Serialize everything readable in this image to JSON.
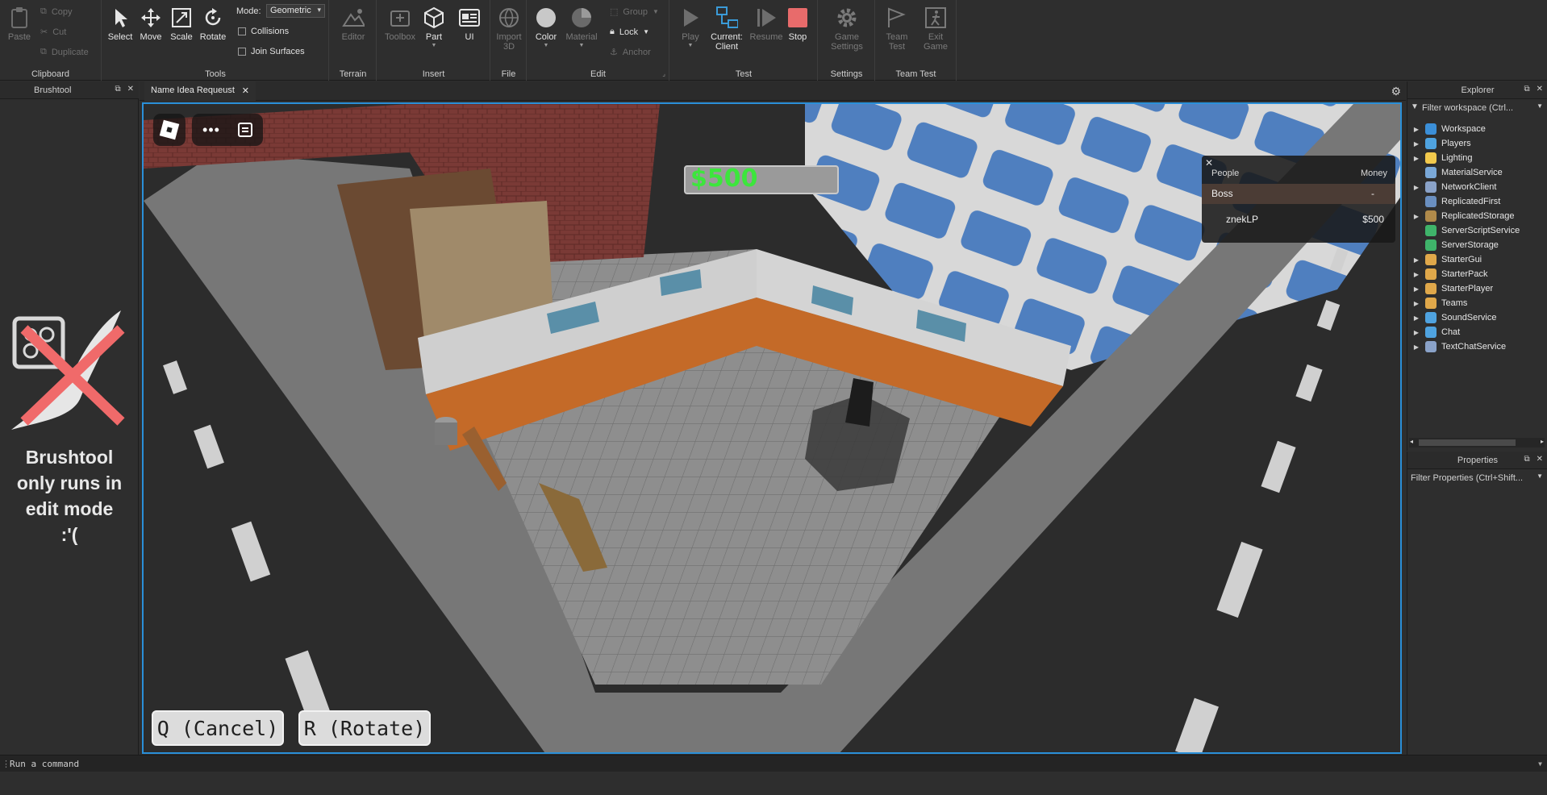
{
  "ribbon": {
    "clipboard": {
      "label": "Clipboard",
      "paste": "Paste",
      "copy": "Copy",
      "cut": "Cut",
      "duplicate": "Duplicate"
    },
    "tools": {
      "label": "Tools",
      "select": "Select",
      "move": "Move",
      "scale": "Scale",
      "rotate": "Rotate",
      "mode_label": "Mode:",
      "mode_value": "Geometric",
      "collisions": "Collisions",
      "join_surfaces": "Join Surfaces"
    },
    "terrain": {
      "label": "Terrain",
      "editor": "Editor"
    },
    "insert": {
      "label": "Insert",
      "toolbox": "Toolbox",
      "part": "Part",
      "ui": "UI"
    },
    "file": {
      "label": "File",
      "import3d_line1": "Import",
      "import3d_line2": "3D"
    },
    "edit": {
      "label": "Edit",
      "color": "Color",
      "material": "Material",
      "group": "Group",
      "lock": "Lock",
      "anchor": "Anchor"
    },
    "test": {
      "label": "Test",
      "play": "Play",
      "current_line1": "Current:",
      "current_line2": "Client",
      "resume": "Resume",
      "stop": "Stop"
    },
    "settings": {
      "label": "Settings",
      "game_settings_line1": "Game",
      "game_settings_line2": "Settings"
    },
    "team_test": {
      "label": "Team Test",
      "team_test_line1": "Team",
      "team_test_line2": "Test",
      "exit_game_line1": "Exit",
      "exit_game_line2": "Game"
    }
  },
  "left_panel": {
    "title": "Brushtool",
    "message_line1": "Brushtool",
    "message_line2": "only runs in",
    "message_line3": "edit mode",
    "message_line4": ":'("
  },
  "tab": {
    "title": "Name Idea Requeust"
  },
  "viewport": {
    "money_display": "$500",
    "leaderboard": {
      "col_people": "People",
      "col_money": "Money",
      "team_name": "Boss",
      "team_value": "-",
      "player_name": "znekLP",
      "player_money": "$500"
    },
    "cancel_button": "Q (Cancel)",
    "rotate_button": "R (Rotate)"
  },
  "explorer": {
    "title": "Explorer",
    "filter_placeholder": "Filter workspace (Ctrl...",
    "items": [
      {
        "name": "Workspace",
        "expandable": true,
        "icon_color": "#3b8fd8"
      },
      {
        "name": "Players",
        "expandable": true,
        "icon_color": "#4fa3e0"
      },
      {
        "name": "Lighting",
        "expandable": true,
        "icon_color": "#f2c94c"
      },
      {
        "name": "MaterialService",
        "expandable": false,
        "icon_color": "#7aa8d8"
      },
      {
        "name": "NetworkClient",
        "expandable": true,
        "icon_color": "#8aa2c8"
      },
      {
        "name": "ReplicatedFirst",
        "expandable": false,
        "icon_color": "#6a8fc0"
      },
      {
        "name": "ReplicatedStorage",
        "expandable": true,
        "icon_color": "#b08a4a"
      },
      {
        "name": "ServerScriptService",
        "expandable": false,
        "icon_color": "#3fb46a"
      },
      {
        "name": "ServerStorage",
        "expandable": false,
        "icon_color": "#3fb46a"
      },
      {
        "name": "StarterGui",
        "expandable": true,
        "icon_color": "#e0a84a"
      },
      {
        "name": "StarterPack",
        "expandable": true,
        "icon_color": "#e0a84a"
      },
      {
        "name": "StarterPlayer",
        "expandable": true,
        "icon_color": "#e0a84a"
      },
      {
        "name": "Teams",
        "expandable": true,
        "icon_color": "#e0a84a"
      },
      {
        "name": "SoundService",
        "expandable": true,
        "icon_color": "#4fa3e0"
      },
      {
        "name": "Chat",
        "expandable": true,
        "icon_color": "#4fa3e0"
      },
      {
        "name": "TextChatService",
        "expandable": true,
        "icon_color": "#8aa2c8"
      }
    ]
  },
  "properties": {
    "title": "Properties",
    "filter_placeholder": "Filter Properties (Ctrl+Shift..."
  },
  "command_bar": {
    "placeholder": "Run a command"
  },
  "colors": {
    "accent": "#2a8fd8",
    "stop": "#e86b6b",
    "money_green": "#3ce63c"
  }
}
